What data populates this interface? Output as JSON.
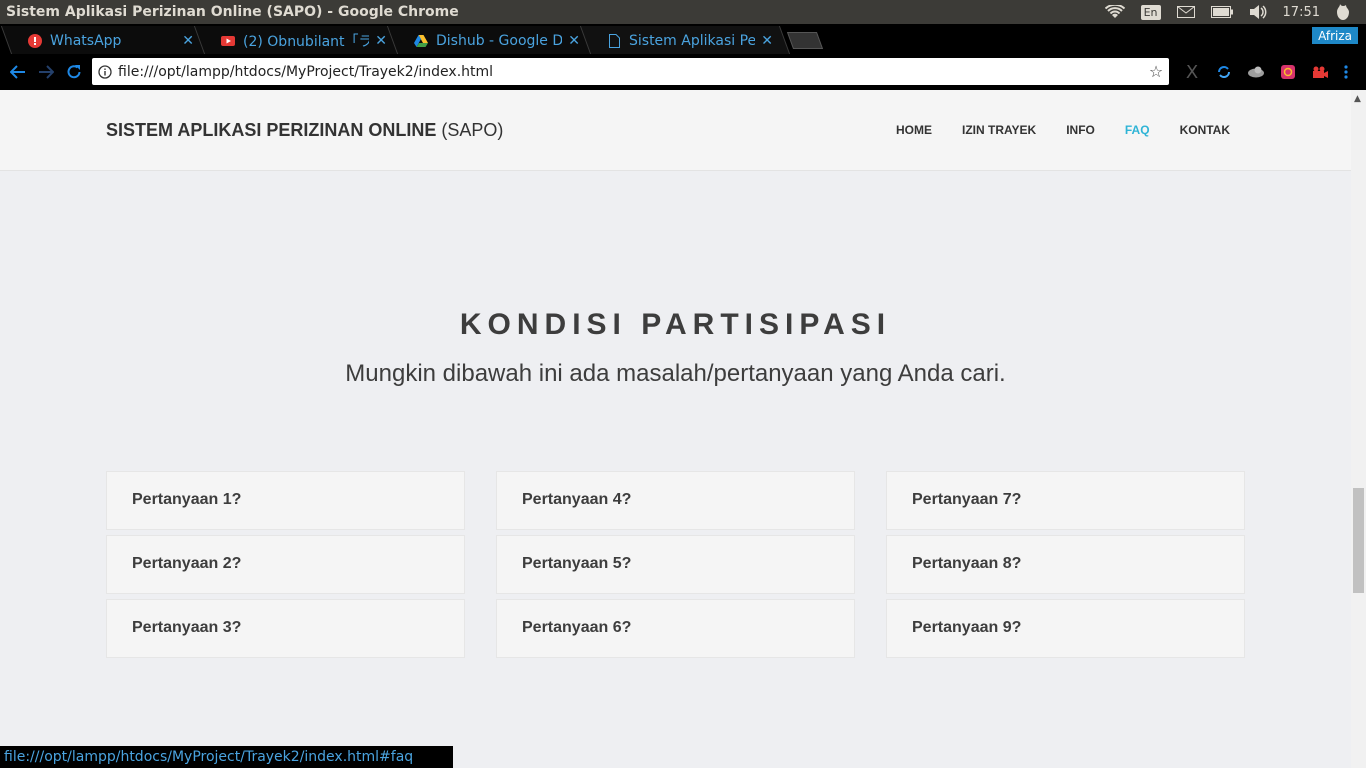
{
  "os": {
    "window_title": "Sistem Aplikasi Perizinan Online (SAPO) - Google Chrome",
    "lang": "En",
    "clock": "17:51"
  },
  "tabs": [
    {
      "label": "WhatsApp",
      "icon": "whatsapp-icon"
    },
    {
      "label": "(2) Obnubilant「ラ",
      "icon": "youtube-icon"
    },
    {
      "label": "Dishub - Google Dr",
      "icon": "google-drive-icon"
    },
    {
      "label": "Sistem Aplikasi Per",
      "icon": "page-icon"
    }
  ],
  "profile": "Afriza",
  "toolbar": {
    "url": "file:///opt/lampp/htdocs/MyProject/Trayek2/index.html"
  },
  "site": {
    "brand_bold": "SISTEM APLIKASI PERIZINAN ONLINE",
    "brand_light": "(SAPO)",
    "menu": [
      {
        "label": "HOME"
      },
      {
        "label": "IZIN TRAYEK"
      },
      {
        "label": "INFO"
      },
      {
        "label": "FAQ",
        "active": true
      },
      {
        "label": "KONTAK"
      }
    ],
    "heading": "KONDISI PARTISIPASI",
    "subheading": "Mungkin dibawah ini ada masalah/pertanyaan yang Anda cari.",
    "faq": [
      "Pertanyaan 1?",
      "Pertanyaan 2?",
      "Pertanyaan 3?",
      "Pertanyaan 4?",
      "Pertanyaan 5?",
      "Pertanyaan 6?",
      "Pertanyaan 7?",
      "Pertanyaan 8?",
      "Pertanyaan 9?"
    ]
  },
  "status_bar": "file:///opt/lampp/htdocs/MyProject/Trayek2/index.html#faq",
  "colors": {
    "accent": "#2fb4d6",
    "link": "#4aa3df"
  }
}
